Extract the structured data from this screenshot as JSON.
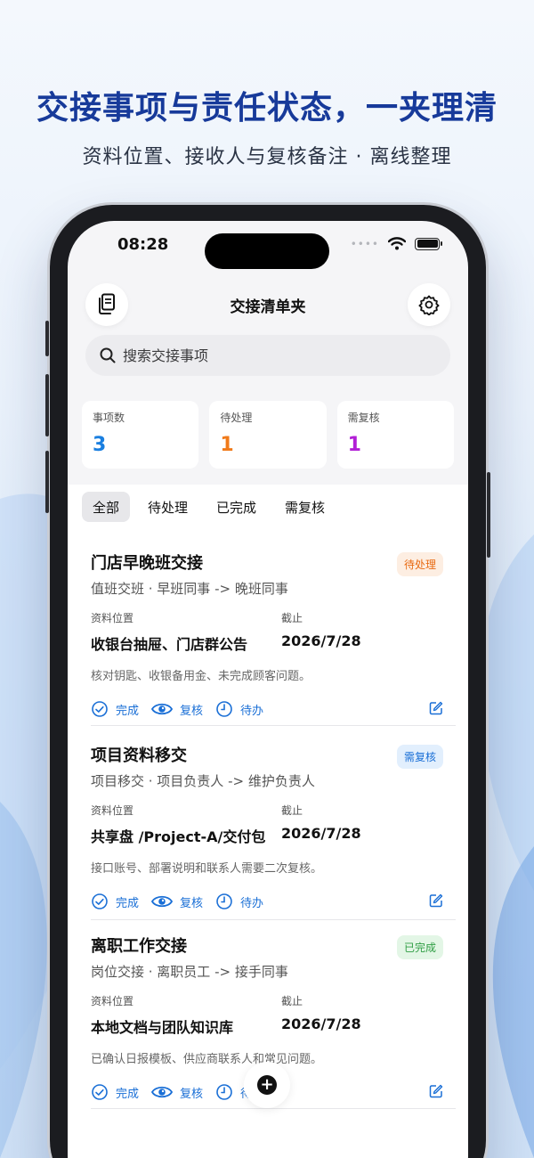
{
  "headline": "交接事项与责任状态，一夹理清",
  "subline": "资料位置、接收人与复核备注 · 离线整理",
  "status_bar": {
    "time": "08:28"
  },
  "nav": {
    "title": "交接清单夹"
  },
  "search": {
    "placeholder": "搜索交接事项"
  },
  "stats": [
    {
      "label": "事项数",
      "value": "3",
      "color": "#1a7fe0"
    },
    {
      "label": "待处理",
      "value": "1",
      "color": "#f07a1a"
    },
    {
      "label": "需复核",
      "value": "1",
      "color": "#b21fd6"
    }
  ],
  "tabs": [
    "全部",
    "待处理",
    "已完成",
    "需复核"
  ],
  "items": [
    {
      "title": "门店早晚班交接",
      "subtitle": "值班交班 · 早班同事 -> 晚班同事",
      "badge": "待处理",
      "location_label": "资料位置",
      "location": "收银台抽屉、门店群公告",
      "due_label": "截止",
      "due": "2026/7/28",
      "note": "核对钥匙、收银备用金、未完成顾客问题。"
    },
    {
      "title": "项目资料移交",
      "subtitle": "项目移交 · 项目负责人 -> 维护负责人",
      "badge": "需复核",
      "location_label": "资料位置",
      "location": "共享盘 /Project-A/交付包",
      "due_label": "截止",
      "due": "2026/7/28",
      "note": "接口账号、部署说明和联系人需要二次复核。"
    },
    {
      "title": "离职工作交接",
      "subtitle": "岗位交接 · 离职员工 -> 接手同事",
      "badge": "已完成",
      "location_label": "资料位置",
      "location": "本地文档与团队知识库",
      "due_label": "截止",
      "due": "2026/7/28",
      "note": "已确认日报模板、供应商联系人和常见问题。"
    }
  ],
  "actions": {
    "complete": "完成",
    "review": "复核",
    "pending": "待办"
  },
  "badge_colors": {
    "pending": {
      "bg": "#fdeee2",
      "fg": "#e86a12"
    },
    "review": {
      "bg": "#e2effd",
      "fg": "#1a6fd6"
    },
    "done": {
      "bg": "#e3f6e6",
      "fg": "#2f9e44"
    }
  },
  "icons": [
    "documents-icon",
    "gear-icon",
    "search-icon",
    "check-circle-icon",
    "eye-icon",
    "clock-icon",
    "edit-icon",
    "plus-icon",
    "wifi-icon",
    "battery-icon"
  ]
}
